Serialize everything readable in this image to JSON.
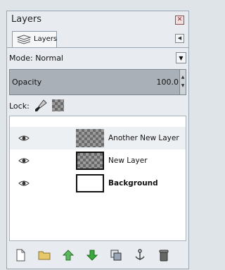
{
  "panel": {
    "title": "Layers"
  },
  "tab": {
    "label": "Layers"
  },
  "mode": {
    "label": "Mode:",
    "value": "Normal"
  },
  "opacity": {
    "label": "Opacity",
    "value": "100.0"
  },
  "lock": {
    "label": "Lock:"
  },
  "layers": [
    {
      "name": "Another New Layer",
      "visible": true,
      "thumb": "transparent",
      "selected": true
    },
    {
      "name": "New Layer",
      "visible": true,
      "thumb": "transparent",
      "selected": false
    },
    {
      "name": "Background",
      "visible": true,
      "thumb": "white",
      "selected": false
    }
  ],
  "toolbar_icons": [
    "new-layer-icon",
    "new-layer-group-icon",
    "raise-layer-icon",
    "lower-layer-icon",
    "duplicate-layer-icon",
    "anchor-layer-icon",
    "delete-layer-icon"
  ],
  "colors": {
    "raise": "#3d9a2f",
    "lower": "#2f9a2f",
    "folder": "#c6a64a",
    "delete": "#555555"
  }
}
